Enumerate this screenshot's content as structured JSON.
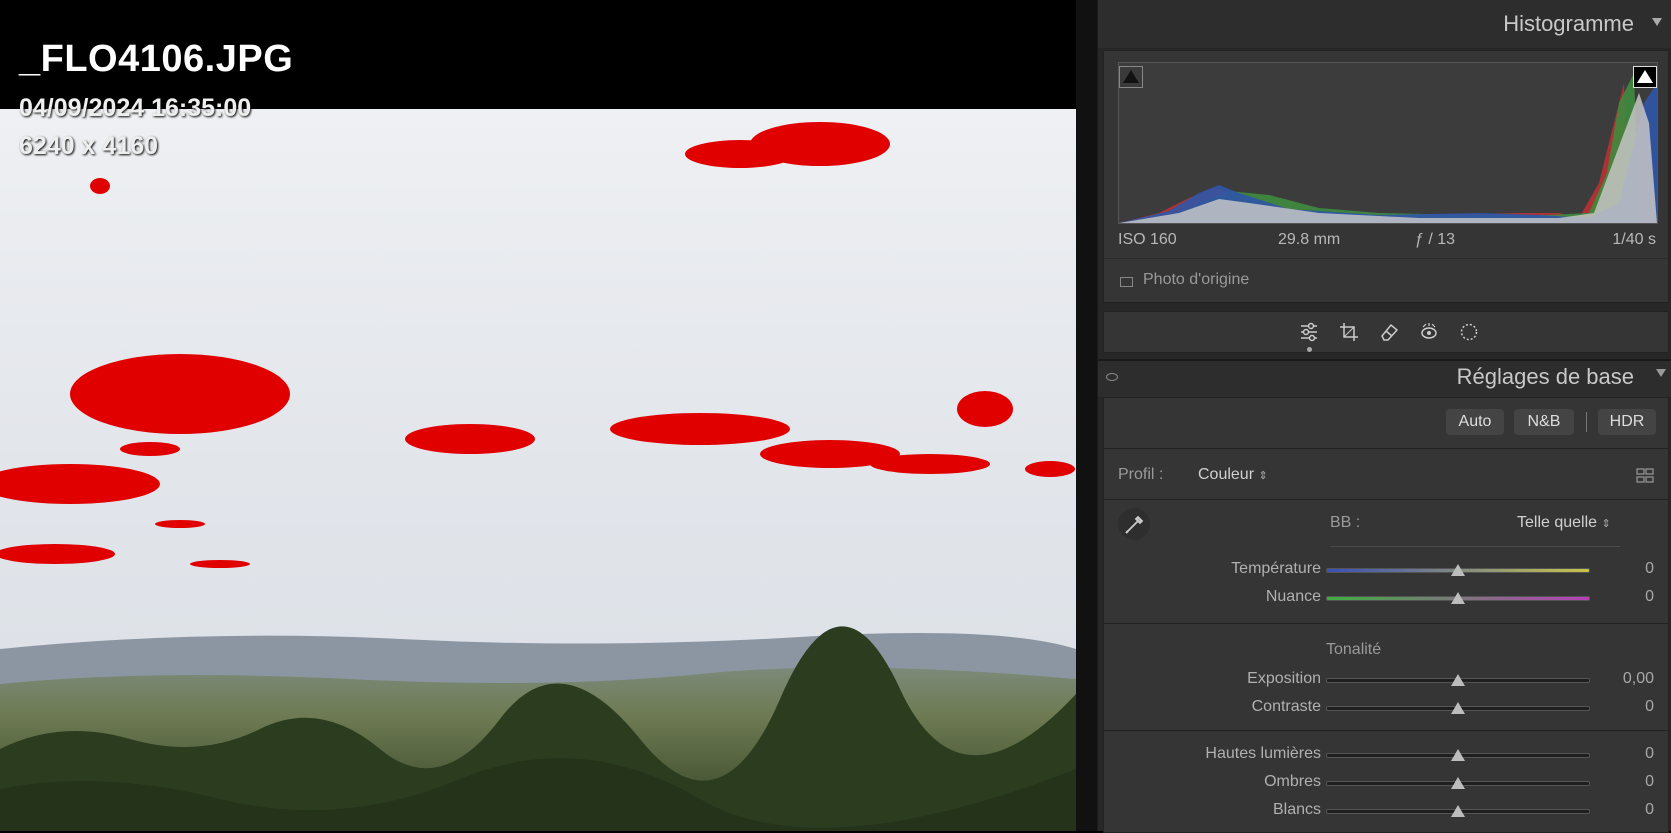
{
  "viewer": {
    "file_name": "_FLO4106.JPG",
    "date": "04/09/2024 16:35:00",
    "dimensions": "6240 x 4160"
  },
  "histogram_panel": {
    "title": "Histogramme",
    "exif": {
      "iso": "ISO 160",
      "focal": "29.8 mm",
      "aperture": "ƒ / 13",
      "shutter": "1/40 s"
    },
    "original_photo_label": "Photo d'origine"
  },
  "tools": [
    "edit-icon",
    "crop-icon",
    "eraser-icon",
    "redeye-icon",
    "mask-icon"
  ],
  "basic_panel": {
    "title": "Réglages de base",
    "buttons": {
      "auto": "Auto",
      "bw": "N&B",
      "hdr": "HDR"
    },
    "profile_label": "Profil :",
    "profile_value": "Couleur",
    "wb_label": "BB :",
    "wb_value": "Telle quelle",
    "tonality_label": "Tonalité",
    "sliders": [
      {
        "label": "Température",
        "value": "0",
        "position": 0.5
      },
      {
        "label": "Nuance",
        "value": "0",
        "position": 0.5
      },
      {
        "label": "Exposition",
        "value": "0,00",
        "position": 0.5
      },
      {
        "label": "Contraste",
        "value": "0",
        "position": 0.5
      },
      {
        "label": "Hautes lumières",
        "value": "0",
        "position": 0.5
      },
      {
        "label": "Ombres",
        "value": "0",
        "position": 0.5
      },
      {
        "label": "Blancs",
        "value": "0",
        "position": 0.5
      }
    ]
  },
  "colors": {
    "clipping_overlay": "#e00000",
    "panel_bg": "#353535"
  }
}
